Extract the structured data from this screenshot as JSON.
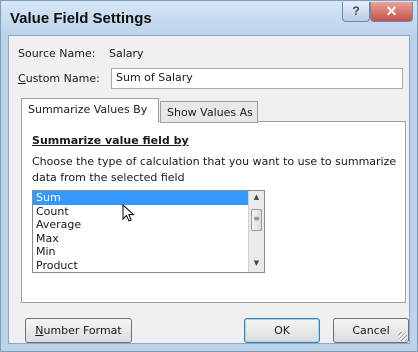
{
  "dialog": {
    "title": "Value Field Settings",
    "help_glyph": "?",
    "close_glyph": "✕"
  },
  "source": {
    "label": "Source Name:",
    "value": "Salary"
  },
  "custom_name": {
    "label_first": "C",
    "label_rest": "ustom Name:",
    "value": "Sum of Salary"
  },
  "tabs": [
    {
      "label": "Summarize Values By",
      "active": true
    },
    {
      "label": "Show Values As",
      "active": false
    }
  ],
  "summarize": {
    "heading_first": "S",
    "heading_rest": "ummarize value field by",
    "instruction": "Choose the type of calculation that you want to use to summarize data from the selected field",
    "options": [
      "Sum",
      "Count",
      "Average",
      "Max",
      "Min",
      "Product"
    ],
    "selected": "Sum"
  },
  "buttons": {
    "number_format_first": "N",
    "number_format_rest": "umber Format",
    "ok": "OK",
    "cancel": "Cancel"
  },
  "icons": [
    "help-icon",
    "close-icon",
    "scroll-up-icon",
    "scroll-down-icon",
    "mouse-cursor-icon",
    "resize-grip-icon"
  ],
  "colors": {
    "selection": "#3399ff",
    "close_button": "#c75050",
    "title_bar": "#bcd3ea"
  }
}
